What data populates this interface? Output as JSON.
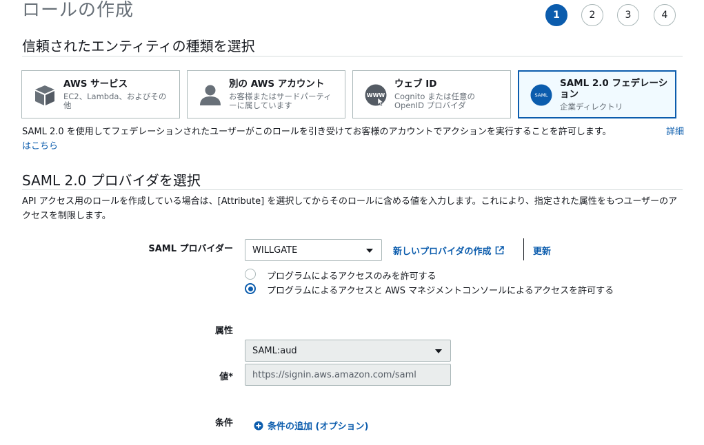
{
  "page_title": "ロールの作成",
  "steps": [
    "1",
    "2",
    "3",
    "4"
  ],
  "active_step": "1",
  "entity_section": {
    "title": "信頼されたエンティティの種類を選択",
    "cards": [
      {
        "title": "AWS サービス",
        "subtitle": "EC2、Lambda、およびその他",
        "icon": "cube-icon"
      },
      {
        "title": "別の AWS アカウント",
        "subtitle": "お客様またはサードパーティーに属しています",
        "icon": "user-icon"
      },
      {
        "title": "ウェブ ID",
        "subtitle": "Cognito または任意の OpenID プロバイダ",
        "icon": "www-icon"
      },
      {
        "title": "SAML 2.0 フェデレーション",
        "subtitle": "企業ディレクトリ",
        "icon": "saml-icon",
        "icon_text": "SAML",
        "selected": true
      }
    ],
    "description": "SAML 2.0 を使用してフェデレーションされたユーザーがこのロールを引き受けてお客様のアカウントでアクションを実行することを許可します。",
    "learn_more_part1": "詳細",
    "learn_more_part2": "はこちら"
  },
  "saml_section": {
    "title": "SAML 2.0 プロバイダを選択",
    "description": "API アクセス用のロールを作成している場合は、[Attribute] を選択してからそのロールに含める値を入力します。これにより、指定された属性をもつユーザーのアクセスを制限します。",
    "provider_label": "SAML プロバイダー",
    "provider_value": "WILLGATE",
    "create_provider_link": "新しいプロバイダの作成",
    "refresh_link": "更新",
    "radio_options": [
      {
        "label": "プログラムによるアクセスのみを許可する",
        "selected": false
      },
      {
        "label": "プログラムによるアクセスと AWS マネジメントコンソールによるアクセスを許可する",
        "selected": true
      }
    ],
    "attribute_label": "属性",
    "attribute_value": "SAML:aud",
    "value_label": "値*",
    "value_value": "https://signin.aws.amazon.com/saml",
    "condition_label": "条件",
    "add_condition_link": "条件の追加 (オプション)"
  },
  "colors": {
    "accent": "#0b5cad",
    "selected_bg": "#f1faff",
    "border": "#aab7b8"
  }
}
